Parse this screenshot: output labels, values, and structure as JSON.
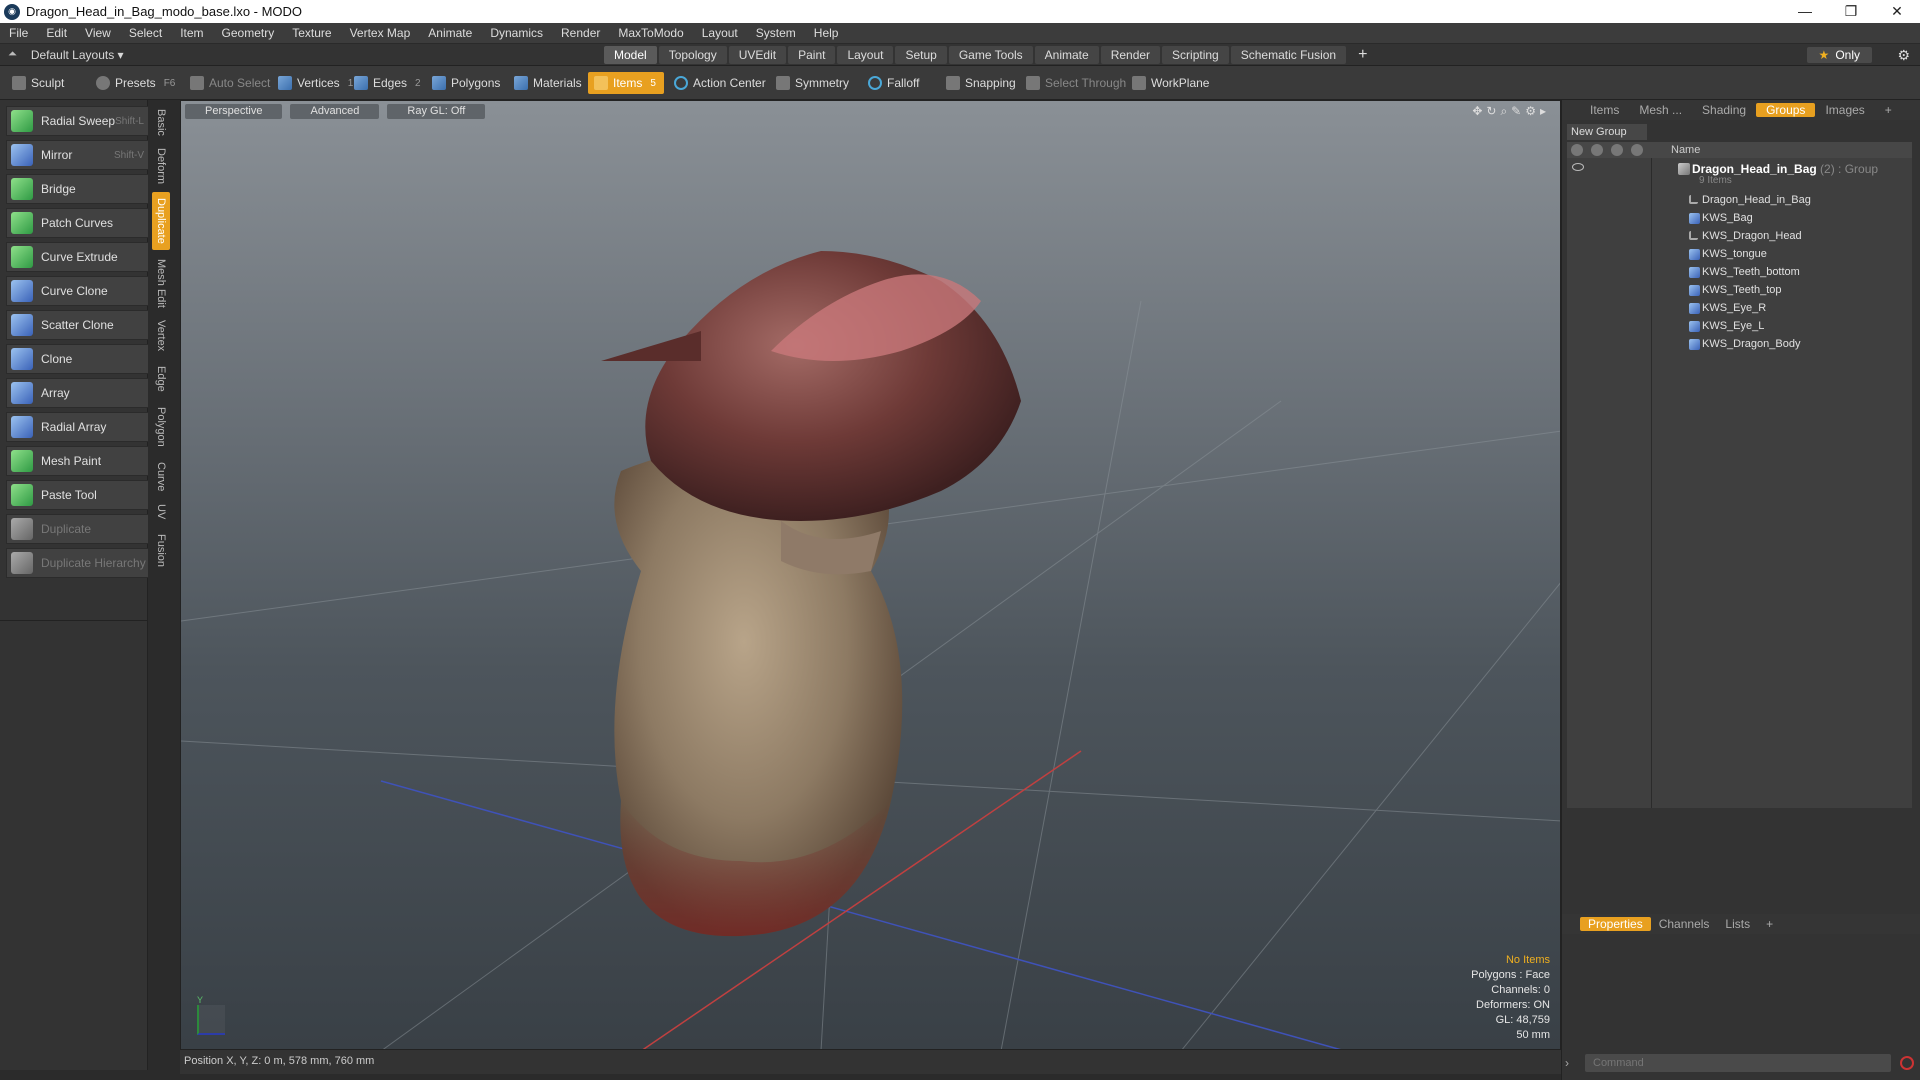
{
  "window": {
    "title": "Dragon_Head_in_Bag_modo_base.lxo - MODO",
    "controls": [
      "—",
      "❐",
      "✕"
    ]
  },
  "menu": [
    "File",
    "Edit",
    "View",
    "Select",
    "Item",
    "Geometry",
    "Texture",
    "Vertex Map",
    "Animate",
    "Dynamics",
    "Render",
    "MaxToModo",
    "Layout",
    "System",
    "Help"
  ],
  "layouts_label": "Default Layouts ▾",
  "mode_tabs": [
    "Model",
    "Topology",
    "UVEdit",
    "Paint",
    "Layout",
    "Setup",
    "Game Tools",
    "Animate",
    "Render",
    "Scripting",
    "Schematic Fusion"
  ],
  "active_mode_tab": "Model",
  "only_label": "Only",
  "toolbar": {
    "sculpt": "Sculpt",
    "presets": "Presets",
    "presets_key": "F6",
    "auto_select": "Auto Select",
    "vertices": "Vertices",
    "vertices_count": "1",
    "edges": "Edges",
    "edges_count": "2",
    "polygons": "Polygons",
    "materials": "Materials",
    "items": "Items",
    "items_count": "5",
    "action_center": "Action Center",
    "symmetry": "Symmetry",
    "falloff": "Falloff",
    "snapping": "Snapping",
    "select_through": "Select Through",
    "workplane": "WorkPlane"
  },
  "tools": [
    {
      "label": "Radial Sweep",
      "shortcut": "Shift-L"
    },
    {
      "label": "Mirror",
      "shortcut": "Shift-V"
    },
    {
      "label": "Bridge",
      "shortcut": ""
    },
    {
      "label": "Patch Curves",
      "shortcut": ""
    },
    {
      "label": "Curve Extrude",
      "shortcut": ""
    },
    {
      "label": "Curve Clone",
      "shortcut": ""
    },
    {
      "label": "Scatter Clone",
      "shortcut": ""
    },
    {
      "label": "Clone",
      "shortcut": ""
    },
    {
      "label": "Array",
      "shortcut": ""
    },
    {
      "label": "Radial Array",
      "shortcut": ""
    },
    {
      "label": "Mesh Paint",
      "shortcut": ""
    },
    {
      "label": "Paste Tool",
      "shortcut": ""
    },
    {
      "label": "Duplicate",
      "shortcut": ""
    },
    {
      "label": "Duplicate Hierarchy",
      "shortcut": ""
    }
  ],
  "side_tabs": [
    "Basic",
    "Deform",
    "Duplicate",
    "Mesh Edit",
    "Vertex",
    "Edge",
    "Polygon",
    "Curve",
    "UV",
    "Fusion"
  ],
  "active_side_tab": "Duplicate",
  "viewport": {
    "view": "Perspective",
    "style": "Advanced",
    "raygl": "Ray GL: Off",
    "info": [
      "No Items",
      "Polygons : Face",
      "Channels: 0",
      "Deformers: ON",
      "GL: 48,759",
      "50 mm"
    ]
  },
  "status": "Position X, Y, Z:  0 m, 578 mm, 760 mm",
  "right_tabs": [
    "Items",
    "Mesh ...",
    "Shading",
    "Groups",
    "Images"
  ],
  "active_right_tab": "Groups",
  "new_group": "New Group",
  "tree_header": "Name",
  "group": {
    "name": "Dragon_Head_in_Bag",
    "suffix": "(2) : Group",
    "sub": "9 Items"
  },
  "tree_items": [
    {
      "label": "Dragon_Head_in_Bag",
      "icon": "locator-icon"
    },
    {
      "label": "KWS_Bag",
      "icon": "mesh-icon"
    },
    {
      "label": "KWS_Dragon_Head",
      "icon": "locator-icon"
    },
    {
      "label": "KWS_tongue",
      "icon": "mesh-icon"
    },
    {
      "label": "KWS_Teeth_bottom",
      "icon": "mesh-icon"
    },
    {
      "label": "KWS_Teeth_top",
      "icon": "mesh-icon"
    },
    {
      "label": "KWS_Eye_R",
      "icon": "mesh-icon"
    },
    {
      "label": "KWS_Eye_L",
      "icon": "mesh-icon"
    },
    {
      "label": "KWS_Dragon_Body",
      "icon": "mesh-icon"
    }
  ],
  "bottom_tabs": [
    "Properties",
    "Channels",
    "Lists"
  ],
  "active_bottom_tab": "Properties",
  "command_placeholder": "Command",
  "colors": {
    "accent": "#e8a020",
    "background": "#333333"
  }
}
